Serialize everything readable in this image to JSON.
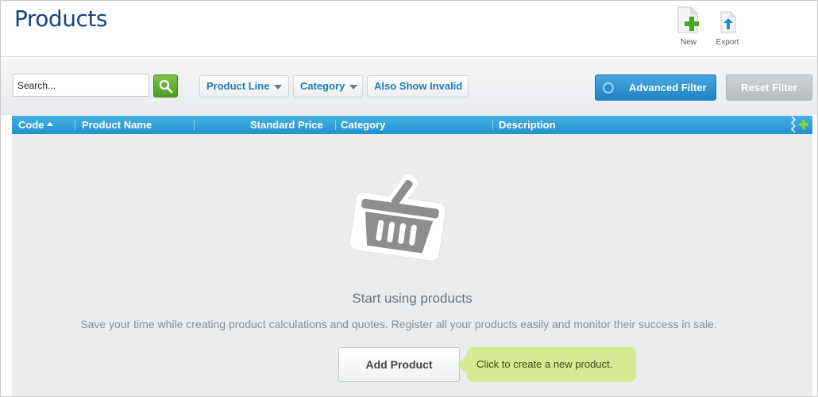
{
  "header": {
    "title": "Products",
    "tools": {
      "new_label": "New",
      "export_label": "Export"
    }
  },
  "toolbar": {
    "search_placeholder": "Search...",
    "filters": {
      "product_line": "Product Line",
      "category": "Category",
      "show_invalid": "Also Show Invalid"
    },
    "advanced_filter": "Advanced Filter",
    "reset_filter": "Reset Filter"
  },
  "grid": {
    "columns": {
      "code": "Code",
      "product_name": "Product Name",
      "standard_price": "Standard Price",
      "category": "Category",
      "description": "Description"
    }
  },
  "empty_state": {
    "title": "Start using products",
    "description": "Save your time while creating product calculations and quotes. Register all your products easily and monitor their success in sale.",
    "button": "Add Product",
    "tip": "Click to create a new product."
  },
  "icons": {
    "new": "new-document-plus-icon",
    "export": "export-arrow-icon",
    "search": "search-icon",
    "basket": "basket-icon",
    "add_column": "plus-icon"
  },
  "colors": {
    "title": "#17447e",
    "accent_blue": "#2193d0",
    "search_green": "#5aa82c",
    "tip_green": "#d6ea93"
  }
}
